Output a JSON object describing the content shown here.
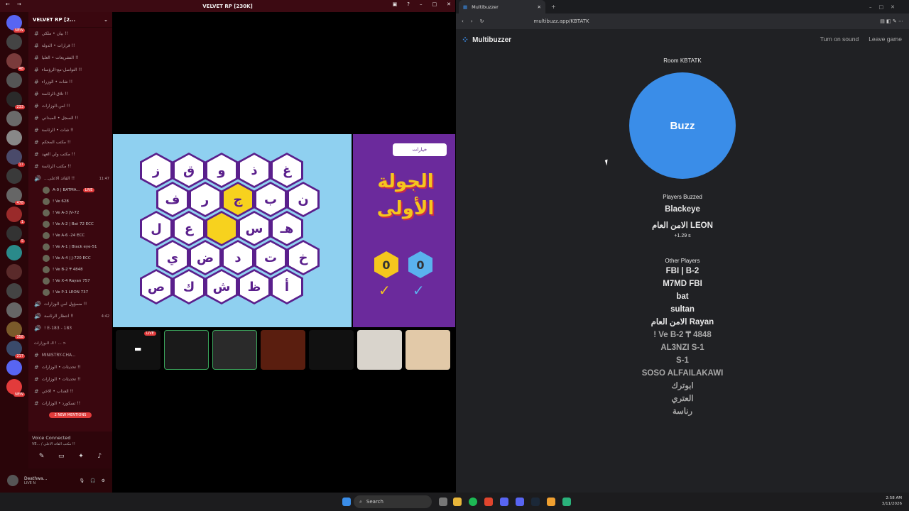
{
  "discord": {
    "window_title": "VELVET RP [230K]",
    "server_name": "VELVET RP [2...",
    "channels": [
      "بيان • ملكي !!",
      "قرارات • الدولة !!",
      "التشريعات • العليا !!",
      "التواصل-مع-الرؤساء !!",
      "شات • الوزراء !!",
      "تلاق-الرئاسة !!",
      "امن-الوزارات !!",
      "السجل • المبداني !!",
      "شات • الرئاسة !!",
      "مكتب المحكم !!",
      "مكتب ولي العهد !!",
      "مكتب الرئاسة !!"
    ],
    "voice_channel": {
      "name": "...القائد الاعلى !!",
      "time": "11:47",
      "live": "LIVE"
    },
    "voice_users": [
      "A-0 | BATMA...",
      "! Ve 628",
      "! Ve A-3 JV-72",
      "! Ve A-2 | Bat 72 ECC",
      "! Ve A-6 -24 ECC",
      "! Ve A-1 | Black eye-51",
      "! Ve A-4 | J-720 ECC",
      "! Ve B-2 ₸ 4848",
      "! Ve X-4 Rayan 757",
      "! Ve P-1 LEON 737"
    ],
    "more_channels": [
      {
        "label": "مسؤول امن الوزارات !!",
        "time": ""
      },
      {
        "label": "انتظار الرئاسة !!",
        "time": "4:42"
      },
      {
        "label": "! E-183 - 183",
        "time": ""
      }
    ],
    "category": "الـ الـوزارات ! ... >",
    "lower_channels": [
      "MINISTRY-CHA...",
      "تحديثات • الوزارات !!",
      "تحديثات • الوزارات !!",
      "العذاب • الاخي !!",
      "تسكورد • الوزارات !!"
    ],
    "mentions": "2 NEW MENTIONS",
    "voice_connected": "Voice Connected",
    "voice_sub": "VE... / مكتب القائد الاعلى !!",
    "username": "Deathwa...",
    "user_status": "LIVE N",
    "server_badges": [
      "NEW",
      "",
      "48",
      "",
      "233",
      "",
      "",
      "17",
      "",
      "478",
      "1",
      "S",
      "",
      "",
      "",
      "",
      "358",
      "217",
      "",
      "NEW"
    ]
  },
  "game": {
    "exit_label": "خيارات",
    "round_title": "الجولة الأولى",
    "letters_row1": [
      "ز",
      "ق",
      "و",
      "ذ",
      "غ"
    ],
    "letters_row2": [
      "ف",
      "ر",
      "ج",
      "ب",
      "ن"
    ],
    "letters_row3": [
      "ل",
      "ع",
      "",
      "س",
      "هـ"
    ],
    "letters_row4": [
      "ي",
      "ض",
      "د",
      "ت",
      "خ"
    ],
    "letters_row5": [
      "ص",
      "ك",
      "ش",
      "ظ",
      "أ"
    ],
    "score_yellow": "0",
    "score_blue": "0",
    "live_tag": "LIVE"
  },
  "browser": {
    "tab_title": "Multibuzzer",
    "url": "multibuzz.app/KBTATK",
    "brand": "Multibuzzer",
    "turn_on_sound": "Turn on sound",
    "leave_game": "Leave game",
    "room": "Room KBTATK",
    "buzz": "Buzz",
    "players_buzzed_label": "Players Buzzed",
    "buzzed": [
      "Blackeye",
      "الامن العام LEON"
    ],
    "buzz_delta": "+1.29 s",
    "other_players_label": "Other Players",
    "other_players": [
      "FBI | B-2",
      "M7MD FBI",
      "bat",
      "sultan",
      "الامن العام Rayan"
    ],
    "inactive_players": [
      "! Ve B-2 ₸ 4848",
      "AL3NZI S-1",
      "S-1",
      "SOSO ALFAILAKAWI",
      "ابوترك",
      "العتري",
      "رناسة"
    ]
  },
  "taskbar": {
    "search": "Search",
    "time": "2:58 AM",
    "date": "3/11/2026"
  },
  "colors": {
    "discord_red": "#3a070f",
    "buzz_blue": "#3a8de8",
    "game_purple": "#6b2a9c"
  }
}
